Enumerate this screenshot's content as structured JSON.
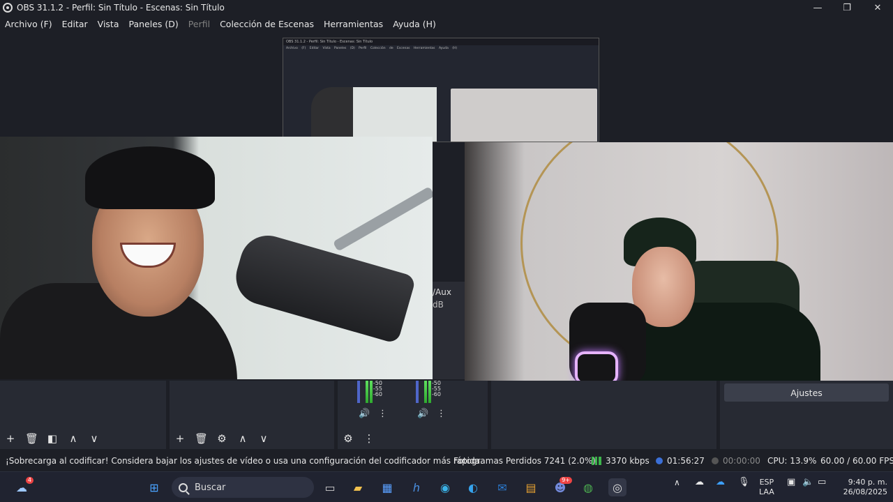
{
  "window": {
    "title": "OBS 31.1.2 - Perfil: Sin Título - Escenas: Sin Título",
    "minimize": "—",
    "maximize": "❐",
    "close": "✕"
  },
  "menu": [
    {
      "label": "Archivo (F)",
      "enabled": true
    },
    {
      "label": "Editar",
      "enabled": true
    },
    {
      "label": "Vista",
      "enabled": true
    },
    {
      "label": "Paneles (D)",
      "enabled": true
    },
    {
      "label": "Perfil",
      "enabled": false
    },
    {
      "label": "Colección de Escenas",
      "enabled": true
    },
    {
      "label": "Herramientas",
      "enabled": true
    },
    {
      "label": "Ayuda (H)",
      "enabled": true
    }
  ],
  "nested": {
    "title": "OBS 31.1.2 - Perfil: Sin Título - Escenas: Sin Título",
    "menu": "Archivo (F) Editar Vista Paneles (D) Perfil Colección de Escenas Herramientas Ayuda (H)"
  },
  "mixer_fragment": {
    "label": "/Aux",
    "db": "dB"
  },
  "mixer": {
    "ticks": [
      "-50",
      "-55",
      "-60"
    ]
  },
  "sources_toolbar": {
    "add": "+",
    "remove": "🗑",
    "filters": "◧",
    "up": "∧",
    "down": "∨"
  },
  "scenes_toolbar": {
    "add": "+",
    "remove": "🗑",
    "settings": "⚙",
    "up": "∧",
    "down": "∨"
  },
  "mixer_toolbar": {
    "advanced": "⚙",
    "menu": "⋮"
  },
  "controls": {
    "settings_label": "Ajustes"
  },
  "status": {
    "warning": "¡Sobrecarga al codificar! Considera bajar los ajustes de vídeo o usa una configuración del codificador más rápida.",
    "dropped": "Fotogramas Perdidos 7241 (2.0%)",
    "bitrate": "3370 kbps",
    "stream_time": "01:56:27",
    "record_time": "00:00:00",
    "cpu": "CPU: 13.9%",
    "fps": "60.00 / 60.00 FPS"
  },
  "taskbar": {
    "search_placeholder": "Buscar",
    "weather_badge": "4",
    "discord_badge": "9+",
    "lang_top": "ESP",
    "lang_bottom": "LAA",
    "time": "9:40 p. m.",
    "date": "26/08/2025"
  },
  "colors": {
    "accent": "#3b3f4b",
    "bg": "#1d1f26",
    "meter_green": "#4fd14f"
  }
}
